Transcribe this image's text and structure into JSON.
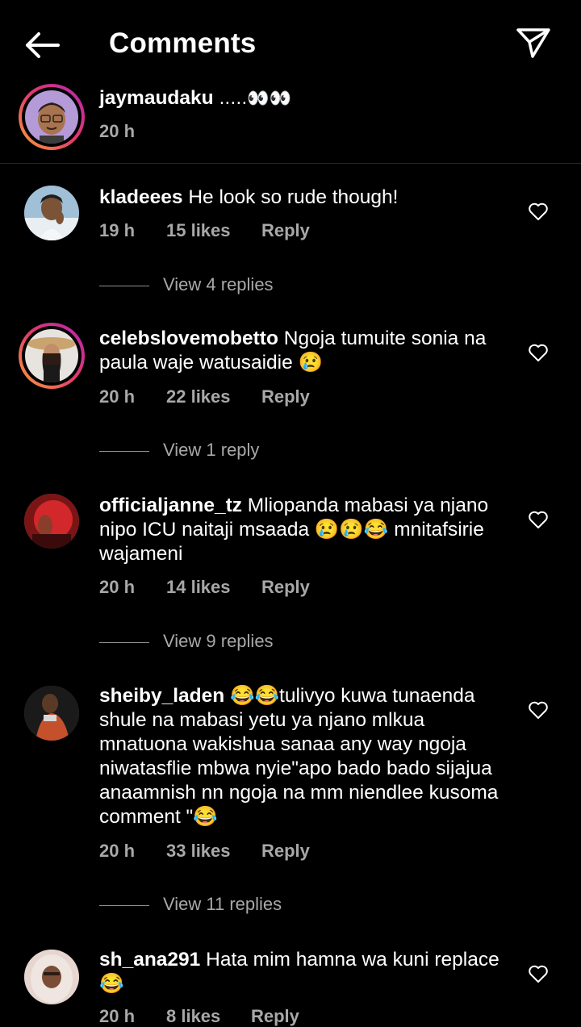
{
  "header": {
    "title": "Comments"
  },
  "caption": {
    "username": "jaymaudaku",
    "text": ".....👀👀",
    "time": "20 h"
  },
  "comments": [
    {
      "username": "kladeees",
      "text": "He look so rude though!",
      "time": "19 h",
      "likes": "15 likes",
      "reply": "Reply",
      "view_replies": "View 4 replies"
    },
    {
      "username": "celebslovemobetto",
      "text": "Ngoja tumuite sonia na paula waje watusaidie 😢",
      "time": "20 h",
      "likes": "22 likes",
      "reply": "Reply",
      "view_replies": "View 1 reply"
    },
    {
      "username": "officialjanne_tz",
      "text": "Mliopanda mabasi ya njano nipo ICU naitaji msaada 😢😢😂 mnitafsirie wajameni",
      "time": "20 h",
      "likes": "14 likes",
      "reply": "Reply",
      "view_replies": "View 9 replies"
    },
    {
      "username": "sheiby_laden",
      "text": "😂😂tulivyo kuwa tunaenda shule na mabasi yetu ya njano mlkua mnatuona wakishua sanaa any way ngoja niwatasflie mbwa nyie\"apo bado bado sijajua anaamnish nn ngoja na mm niendlee kusoma comment \"😂",
      "time": "20 h",
      "likes": "33 likes",
      "reply": "Reply",
      "view_replies": "View 11 replies"
    },
    {
      "username": "sh_ana291",
      "text": "Hata mim hamna wa kuni replace 😂",
      "time": "20 h",
      "likes": "8 likes",
      "reply": "Reply"
    }
  ],
  "colors": {
    "background": "#000000",
    "text": "#ffffff",
    "muted": "#a8a8a8",
    "divider": "#262626"
  },
  "icons": {
    "back": "arrow-left-icon",
    "share": "paper-plane-icon",
    "like": "heart-outline-icon"
  }
}
